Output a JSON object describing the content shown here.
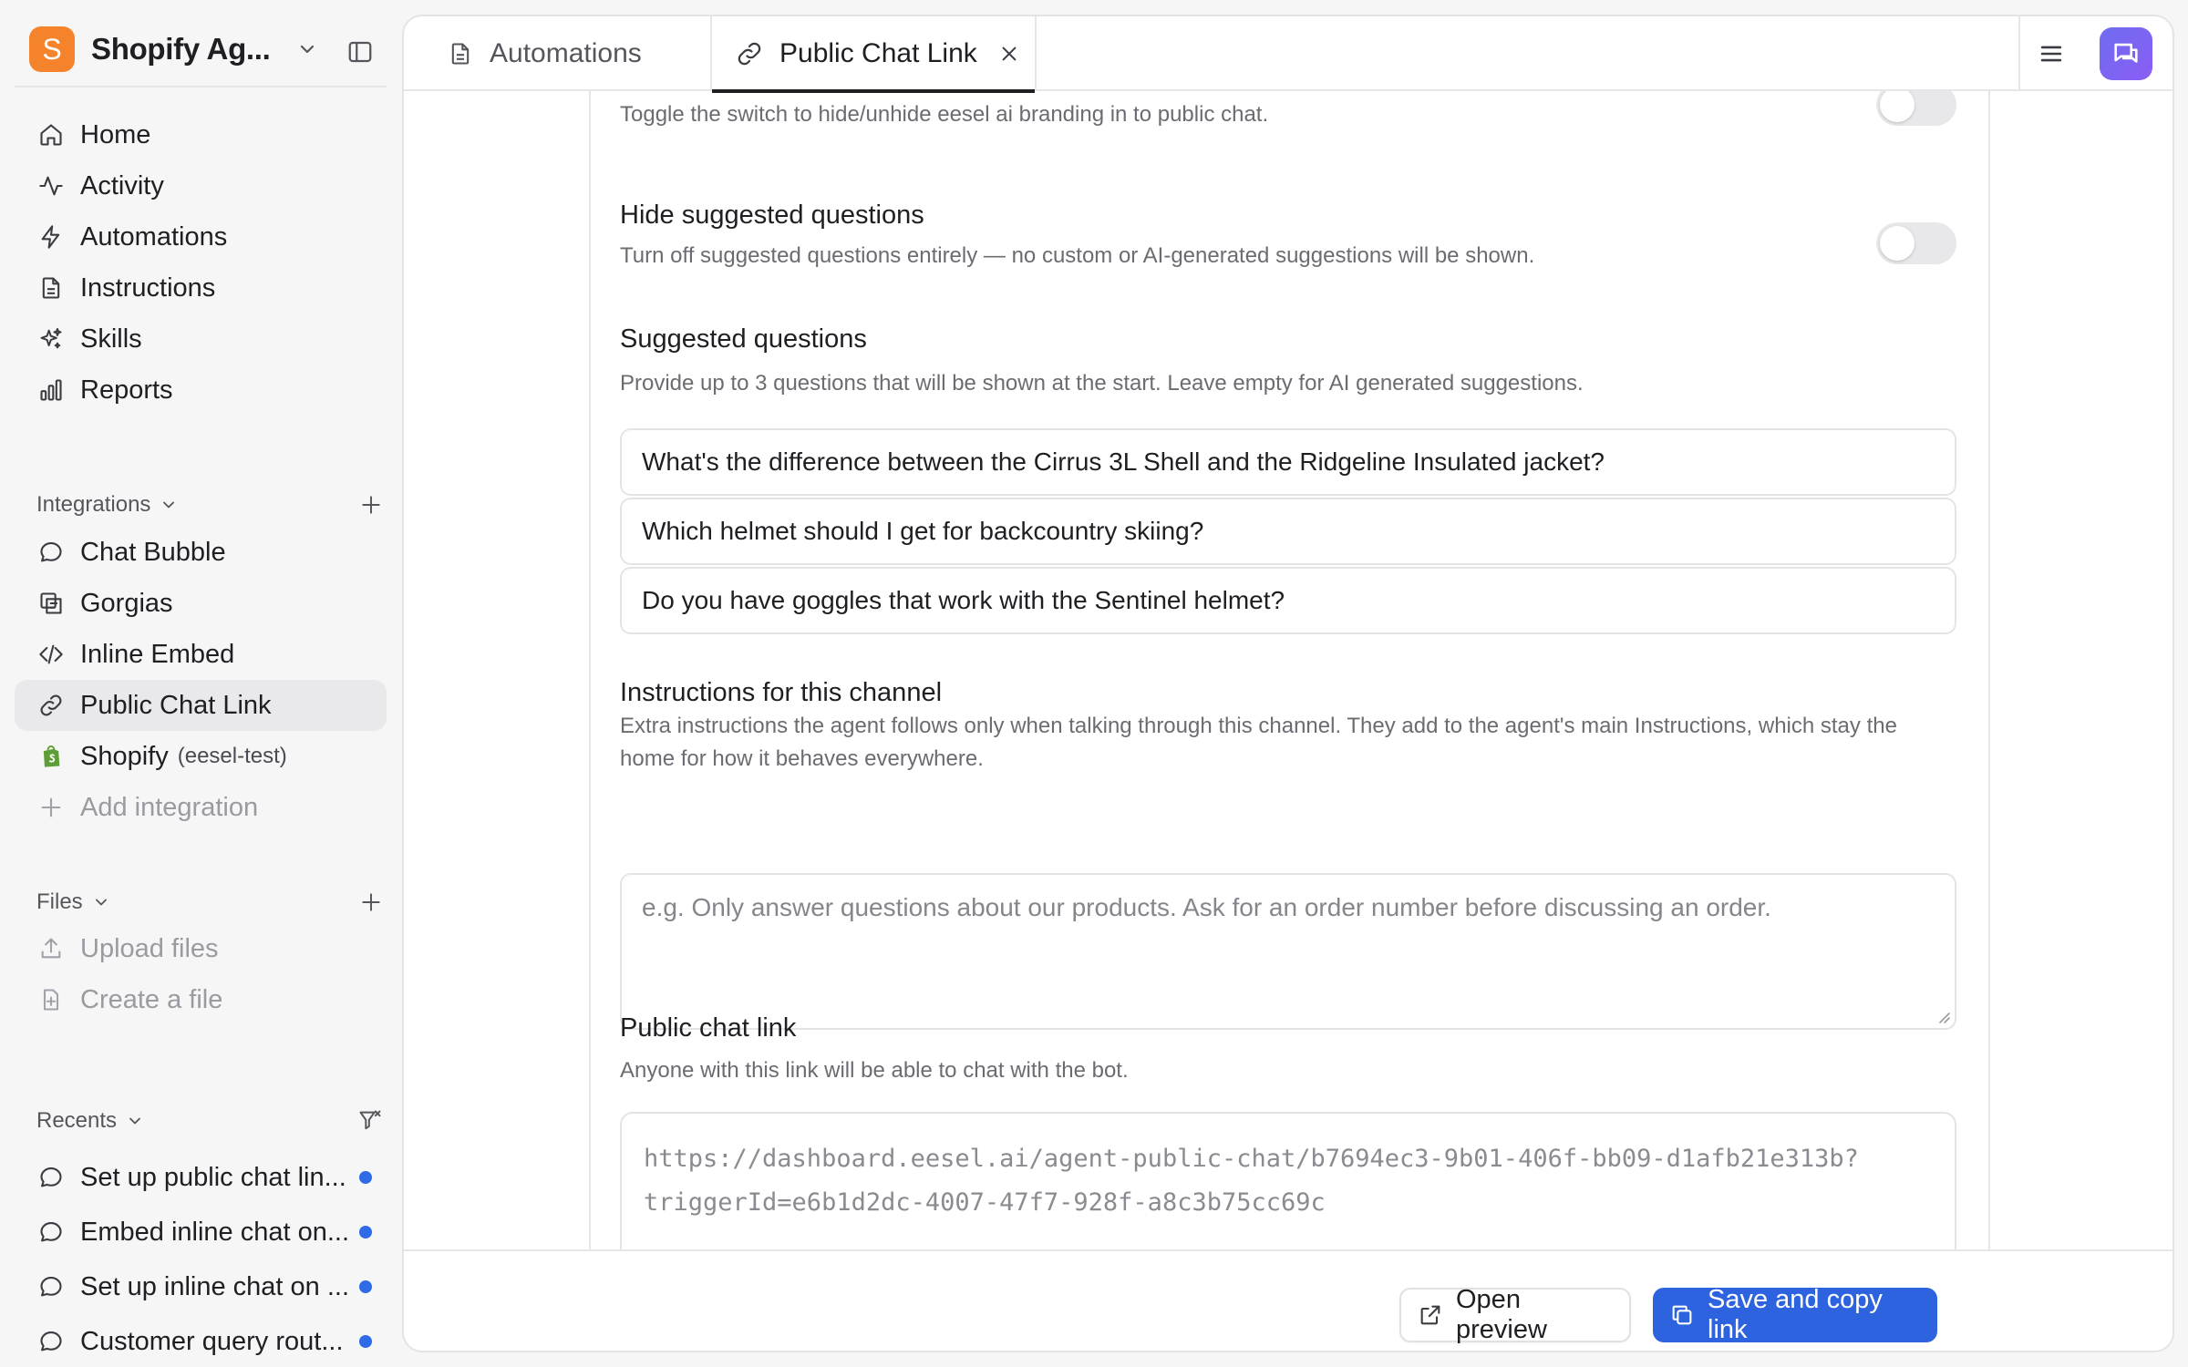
{
  "workspace": {
    "logo_letter": "S",
    "name": "Shopify Ag..."
  },
  "nav": [
    {
      "label": "Home",
      "icon": "home-icon"
    },
    {
      "label": "Activity",
      "icon": "activity-icon"
    },
    {
      "label": "Automations",
      "icon": "bolt-icon"
    },
    {
      "label": "Instructions",
      "icon": "document-icon"
    },
    {
      "label": "Skills",
      "icon": "sparkles-icon"
    },
    {
      "label": "Reports",
      "icon": "bar-chart-icon"
    }
  ],
  "integrations": {
    "title": "Integrations",
    "items": [
      {
        "label": "Chat Bubble",
        "icon": "chat-bubble-icon"
      },
      {
        "label": "Gorgias",
        "icon": "gorgias-icon"
      },
      {
        "label": "Inline Embed",
        "icon": "code-icon"
      },
      {
        "label": "Public Chat Link",
        "icon": "link-icon",
        "active": true
      },
      {
        "label": "Shopify",
        "sub": "(eesel-test)",
        "icon": "shopify-icon"
      }
    ],
    "add_label": "Add integration"
  },
  "files": {
    "title": "Files",
    "upload_label": "Upload files",
    "create_label": "Create a file"
  },
  "recents": {
    "title": "Recents",
    "items": [
      {
        "label": "Set up public chat lin..."
      },
      {
        "label": "Embed inline chat on..."
      },
      {
        "label": "Set up inline chat on ..."
      },
      {
        "label": "Customer query rout..."
      }
    ]
  },
  "tabs": [
    {
      "label": "Automations",
      "icon": "document-icon"
    },
    {
      "label": "Public Chat Link",
      "icon": "link-icon",
      "active": true
    }
  ],
  "settings": {
    "branding_desc": "Toggle the switch to hide/unhide eesel ai branding in to public chat.",
    "hide_suggested": {
      "label": "Hide suggested questions",
      "desc": "Turn off suggested questions entirely — no custom or AI-generated suggestions will be shown."
    },
    "suggested": {
      "label": "Suggested questions",
      "desc": "Provide up to 3 questions that will be shown at the start. Leave empty for AI generated suggestions.",
      "questions": [
        "What's the difference between the Cirrus 3L Shell and the Ridgeline Insulated jacket?",
        "Which helmet should I get for backcountry skiing?",
        "Do you have goggles that work with the Sentinel helmet?"
      ]
    },
    "instructions": {
      "label": "Instructions for this channel",
      "desc_line1": "Extra instructions the agent follows only when talking through this channel. They add to the agent's main Instructions, which stay the",
      "desc_line2": "home for how it behaves everywhere.",
      "placeholder": "e.g. Only answer questions about our products. Ask for an order number before discussing an order."
    },
    "public_link": {
      "label": "Public chat link",
      "desc": "Anyone with this link will be able to chat with the bot.",
      "url_line1": "https://dashboard.eesel.ai/agent-public-chat/b7694ec3-9b01-406f-bb09-d1afb21e313b?",
      "url_line2": "triggerId=e6b1d2dc-4007-47f7-928f-a8c3b75cc69c"
    }
  },
  "footer": {
    "preview_label": "Open preview",
    "save_label": "Save and copy link"
  },
  "colors": {
    "accent": "#2e63e0",
    "logo": "#f5832b",
    "unread_dot": "#2f6be6",
    "chat_button": "#7b66f3"
  }
}
